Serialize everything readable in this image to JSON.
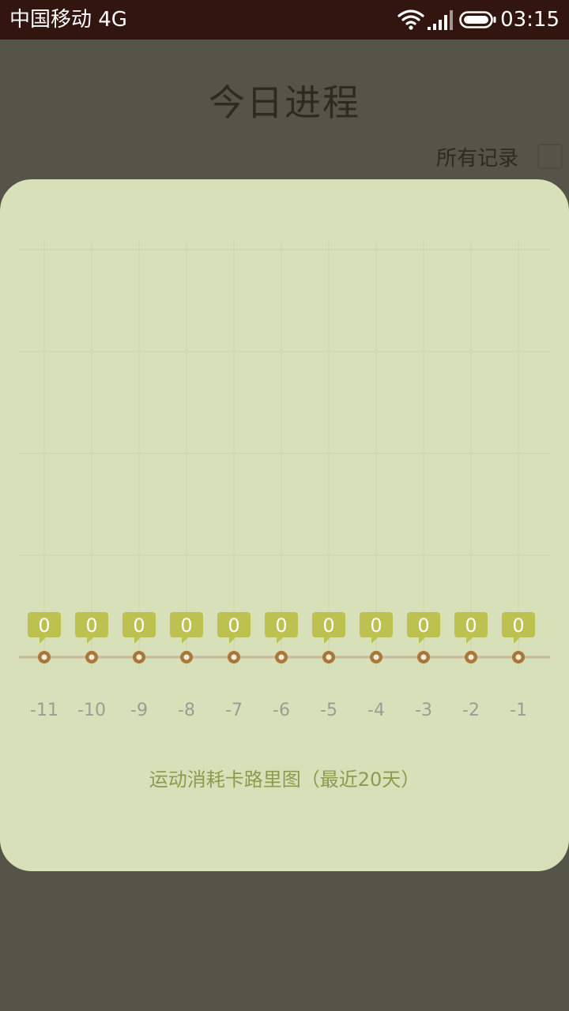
{
  "status_bar": {
    "carrier": "中国移动 4G",
    "time": "03:15"
  },
  "page": {
    "title": "今日进程",
    "all_records_label": "所有记录"
  },
  "chart_data": {
    "type": "line",
    "title": "运动消耗卡路里图（最近20天）",
    "categories": [
      "-11",
      "-10",
      "-9",
      "-8",
      "-7",
      "-6",
      "-5",
      "-4",
      "-3",
      "-2",
      "-1"
    ],
    "series": [
      {
        "values": [
          0,
          0,
          0,
          0,
          0,
          0,
          0,
          0,
          0,
          0,
          0
        ]
      }
    ],
    "grid": true,
    "colors": {
      "line": "#c8b89a",
      "point": "#a8773a",
      "label_bubble": "#bcc14f",
      "grid": "#cfd6b0",
      "tick_label": "#9a9e92"
    }
  }
}
